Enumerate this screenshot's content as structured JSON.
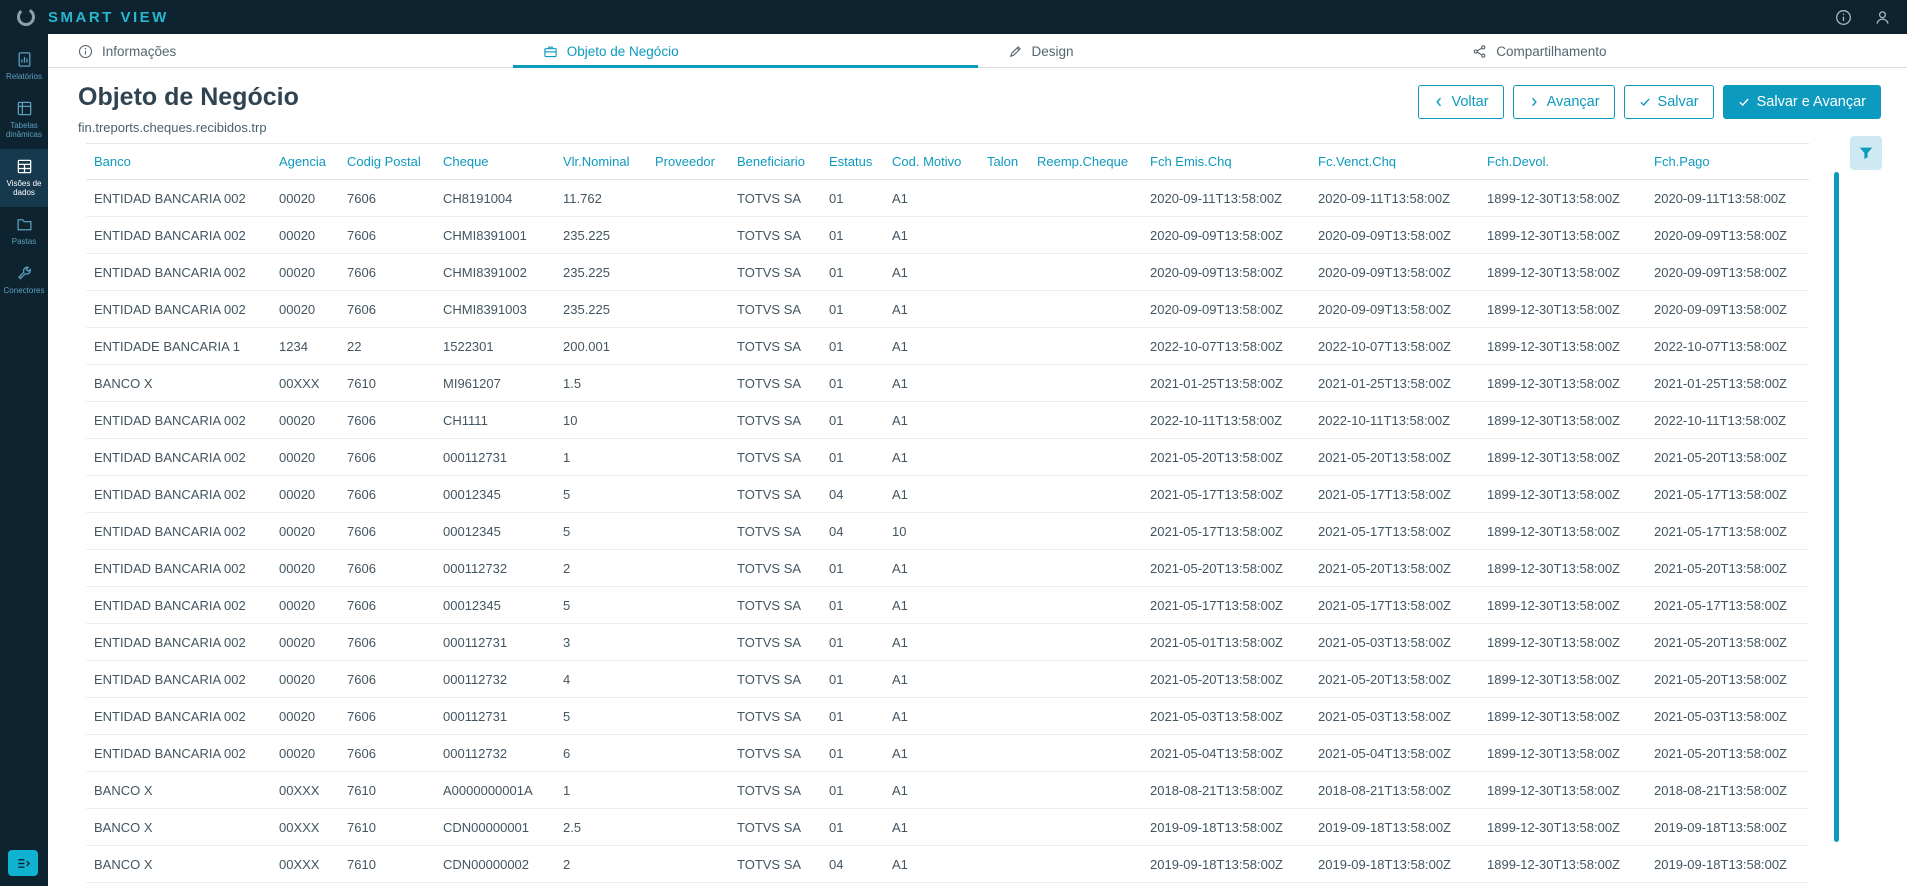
{
  "colors": {
    "accent": "#0c9abe",
    "topbar_bg": "#0d2330",
    "brand_teal": "#29b7cf"
  },
  "topbar": {
    "app_title": "SMART VIEW"
  },
  "sidebar": {
    "items": [
      {
        "label": "Relatórios",
        "icon": "report-icon",
        "active": false
      },
      {
        "label": "Tabelas dinâmicas",
        "icon": "pivot-table-icon",
        "active": false
      },
      {
        "label": "Visões de dados",
        "icon": "data-views-icon",
        "active": true
      },
      {
        "label": "Pastas",
        "icon": "folder-icon",
        "active": false
      },
      {
        "label": "Conectores",
        "icon": "connector-icon",
        "active": false
      }
    ]
  },
  "tabs": [
    {
      "label": "Informações",
      "icon": "info-icon",
      "active": false
    },
    {
      "label": "Objeto de Negócio",
      "icon": "briefcase-icon",
      "active": true
    },
    {
      "label": "Design",
      "icon": "design-icon",
      "active": false
    },
    {
      "label": "Compartilhamento",
      "icon": "share-icon",
      "active": false
    }
  ],
  "header": {
    "title": "Objeto de Negócio",
    "subtitle": "fin.treports.cheques.recibidos.trp",
    "buttons": {
      "voltar": "Voltar",
      "avancar": "Avançar",
      "salvar": "Salvar",
      "salvar_avancar": "Salvar e Avançar"
    }
  },
  "table": {
    "columns": [
      {
        "key": "banco",
        "label": "Banco"
      },
      {
        "key": "agencia",
        "label": "Agencia"
      },
      {
        "key": "codig_postal",
        "label": "Codig Postal"
      },
      {
        "key": "cheque",
        "label": "Cheque"
      },
      {
        "key": "vlr_nominal",
        "label": "Vlr.Nominal"
      },
      {
        "key": "proveedor",
        "label": "Proveedor"
      },
      {
        "key": "beneficiario",
        "label": "Beneficiario"
      },
      {
        "key": "estatus",
        "label": "Estatus"
      },
      {
        "key": "cod_motivo",
        "label": "Cod. Motivo"
      },
      {
        "key": "talon",
        "label": "Talon"
      },
      {
        "key": "reemp_cheque",
        "label": "Reemp.Cheque"
      },
      {
        "key": "fch_emis_chq",
        "label": "Fch Emis.Chq"
      },
      {
        "key": "fc_venct_chq",
        "label": "Fc.Venct.Chq"
      },
      {
        "key": "fch_devol",
        "label": "Fch.Devol."
      },
      {
        "key": "fch_pago",
        "label": "Fch.Pago"
      }
    ],
    "rows": [
      [
        "ENTIDAD BANCARIA 002",
        "00020",
        "7606",
        "CH8191004",
        "11.762",
        "",
        "TOTVS SA",
        "01",
        "A1",
        "",
        "",
        "2020-09-11T13:58:00Z",
        "2020-09-11T13:58:00Z",
        "1899-12-30T13:58:00Z",
        "2020-09-11T13:58:00Z"
      ],
      [
        "ENTIDAD BANCARIA 002",
        "00020",
        "7606",
        "CHMI8391001",
        "235.225",
        "",
        "TOTVS SA",
        "01",
        "A1",
        "",
        "",
        "2020-09-09T13:58:00Z",
        "2020-09-09T13:58:00Z",
        "1899-12-30T13:58:00Z",
        "2020-09-09T13:58:00Z"
      ],
      [
        "ENTIDAD BANCARIA 002",
        "00020",
        "7606",
        "CHMI8391002",
        "235.225",
        "",
        "TOTVS SA",
        "01",
        "A1",
        "",
        "",
        "2020-09-09T13:58:00Z",
        "2020-09-09T13:58:00Z",
        "1899-12-30T13:58:00Z",
        "2020-09-09T13:58:00Z"
      ],
      [
        "ENTIDAD BANCARIA 002",
        "00020",
        "7606",
        "CHMI8391003",
        "235.225",
        "",
        "TOTVS SA",
        "01",
        "A1",
        "",
        "",
        "2020-09-09T13:58:00Z",
        "2020-09-09T13:58:00Z",
        "1899-12-30T13:58:00Z",
        "2020-09-09T13:58:00Z"
      ],
      [
        "ENTIDADE BANCARIA 1",
        "1234",
        "22",
        "1522301",
        "200.001",
        "",
        "TOTVS SA",
        "01",
        "A1",
        "",
        "",
        "2022-10-07T13:58:00Z",
        "2022-10-07T13:58:00Z",
        "1899-12-30T13:58:00Z",
        "2022-10-07T13:58:00Z"
      ],
      [
        "BANCO X",
        "00XXX",
        "7610",
        "MI961207",
        "1.5",
        "",
        "TOTVS SA",
        "01",
        "A1",
        "",
        "",
        "2021-01-25T13:58:00Z",
        "2021-01-25T13:58:00Z",
        "1899-12-30T13:58:00Z",
        "2021-01-25T13:58:00Z"
      ],
      [
        "ENTIDAD BANCARIA 002",
        "00020",
        "7606",
        "CH1111",
        "10",
        "",
        "TOTVS SA",
        "01",
        "A1",
        "",
        "",
        "2022-10-11T13:58:00Z",
        "2022-10-11T13:58:00Z",
        "1899-12-30T13:58:00Z",
        "2022-10-11T13:58:00Z"
      ],
      [
        "ENTIDAD BANCARIA 002",
        "00020",
        "7606",
        "000112731",
        "1",
        "",
        "TOTVS SA",
        "01",
        "A1",
        "",
        "",
        "2021-05-20T13:58:00Z",
        "2021-05-20T13:58:00Z",
        "1899-12-30T13:58:00Z",
        "2021-05-20T13:58:00Z"
      ],
      [
        "ENTIDAD BANCARIA 002",
        "00020",
        "7606",
        "00012345",
        "5",
        "",
        "TOTVS SA",
        "04",
        "A1",
        "",
        "",
        "2021-05-17T13:58:00Z",
        "2021-05-17T13:58:00Z",
        "1899-12-30T13:58:00Z",
        "2021-05-17T13:58:00Z"
      ],
      [
        "ENTIDAD BANCARIA 002",
        "00020",
        "7606",
        "00012345",
        "5",
        "",
        "TOTVS SA",
        "04",
        "10",
        "",
        "",
        "2021-05-17T13:58:00Z",
        "2021-05-17T13:58:00Z",
        "1899-12-30T13:58:00Z",
        "2021-05-17T13:58:00Z"
      ],
      [
        "ENTIDAD BANCARIA 002",
        "00020",
        "7606",
        "000112732",
        "2",
        "",
        "TOTVS SA",
        "01",
        "A1",
        "",
        "",
        "2021-05-20T13:58:00Z",
        "2021-05-20T13:58:00Z",
        "1899-12-30T13:58:00Z",
        "2021-05-20T13:58:00Z"
      ],
      [
        "ENTIDAD BANCARIA 002",
        "00020",
        "7606",
        "00012345",
        "5",
        "",
        "TOTVS SA",
        "01",
        "A1",
        "",
        "",
        "2021-05-17T13:58:00Z",
        "2021-05-17T13:58:00Z",
        "1899-12-30T13:58:00Z",
        "2021-05-17T13:58:00Z"
      ],
      [
        "ENTIDAD BANCARIA 002",
        "00020",
        "7606",
        "000112731",
        "3",
        "",
        "TOTVS SA",
        "01",
        "A1",
        "",
        "",
        "2021-05-01T13:58:00Z",
        "2021-05-03T13:58:00Z",
        "1899-12-30T13:58:00Z",
        "2021-05-20T13:58:00Z"
      ],
      [
        "ENTIDAD BANCARIA 002",
        "00020",
        "7606",
        "000112732",
        "4",
        "",
        "TOTVS SA",
        "01",
        "A1",
        "",
        "",
        "2021-05-20T13:58:00Z",
        "2021-05-20T13:58:00Z",
        "1899-12-30T13:58:00Z",
        "2021-05-20T13:58:00Z"
      ],
      [
        "ENTIDAD BANCARIA 002",
        "00020",
        "7606",
        "000112731",
        "5",
        "",
        "TOTVS SA",
        "01",
        "A1",
        "",
        "",
        "2021-05-03T13:58:00Z",
        "2021-05-03T13:58:00Z",
        "1899-12-30T13:58:00Z",
        "2021-05-03T13:58:00Z"
      ],
      [
        "ENTIDAD BANCARIA 002",
        "00020",
        "7606",
        "000112732",
        "6",
        "",
        "TOTVS SA",
        "01",
        "A1",
        "",
        "",
        "2021-05-04T13:58:00Z",
        "2021-05-04T13:58:00Z",
        "1899-12-30T13:58:00Z",
        "2021-05-20T13:58:00Z"
      ],
      [
        "BANCO X",
        "00XXX",
        "7610",
        "A0000000001A",
        "1",
        "",
        "TOTVS SA",
        "01",
        "A1",
        "",
        "",
        "2018-08-21T13:58:00Z",
        "2018-08-21T13:58:00Z",
        "1899-12-30T13:58:00Z",
        "2018-08-21T13:58:00Z"
      ],
      [
        "BANCO X",
        "00XXX",
        "7610",
        "CDN00000001",
        "2.5",
        "",
        "TOTVS SA",
        "01",
        "A1",
        "",
        "",
        "2019-09-18T13:58:00Z",
        "2019-09-18T13:58:00Z",
        "1899-12-30T13:58:00Z",
        "2019-09-18T13:58:00Z"
      ],
      [
        "BANCO X",
        "00XXX",
        "7610",
        "CDN00000002",
        "2",
        "",
        "TOTVS SA",
        "04",
        "A1",
        "",
        "",
        "2019-09-18T13:58:00Z",
        "2019-09-18T13:58:00Z",
        "1899-12-30T13:58:00Z",
        "2019-09-18T13:58:00Z"
      ]
    ]
  }
}
